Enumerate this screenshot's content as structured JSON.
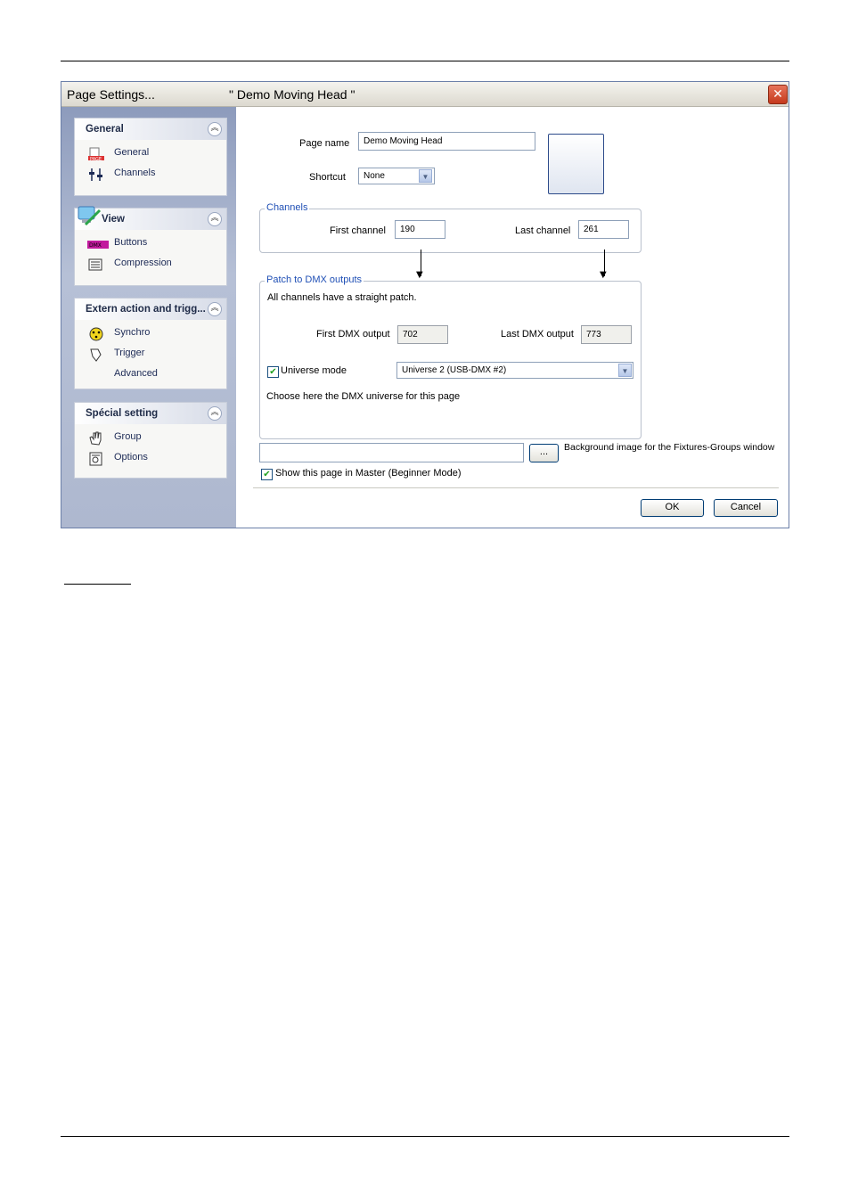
{
  "dialog": {
    "title": "Page  Settings...",
    "page_label": "\" Demo Moving Head \"",
    "close_glyph": "✕"
  },
  "sidebar": {
    "panels": [
      {
        "title": "General",
        "items": [
          {
            "label": "General",
            "icon": "page-icon"
          },
          {
            "label": "Channels",
            "icon": "faders-icon"
          }
        ]
      },
      {
        "title": "View",
        "items": [
          {
            "label": "Buttons",
            "icon": "buttons-icon"
          },
          {
            "label": "Compression",
            "icon": "compression-icon"
          }
        ]
      },
      {
        "title": "Extern action and trigg...",
        "items": [
          {
            "label": "Synchro",
            "icon": "synchro-icon"
          },
          {
            "label": "Trigger",
            "icon": "trigger-icon"
          },
          {
            "label": "Advanced",
            "icon": ""
          }
        ]
      },
      {
        "title": "Spécial setting",
        "items": [
          {
            "label": "Group",
            "icon": "hand-icon"
          },
          {
            "label": "Options",
            "icon": "options-icon"
          }
        ]
      }
    ]
  },
  "form": {
    "page_name_label": "Page name",
    "page_name_value": "Demo Moving Head",
    "shortcut_label": "Shortcut",
    "shortcut_value": "None",
    "channels_legend": "Channels",
    "first_channel_label": "First channel",
    "first_channel_value": "190",
    "last_channel_label": "Last channel",
    "last_channel_value": "261",
    "patch_legend": "Patch to DMX outputs",
    "patch_note": "All channels have a straight patch.",
    "first_dmx_label": "First DMX output",
    "first_dmx_value": "702",
    "last_dmx_label": "Last DMX output",
    "last_dmx_value": "773",
    "universe_mode_label": "Universe mode",
    "universe_mode_checked": true,
    "universe_value": "Universe  2    (USB-DMX #2)",
    "universe_hint": "Choose here the DMX universe for this page",
    "bg_image_value": "",
    "browse_label": "...",
    "bg_image_label": "Background image for the Fixtures-Groups window",
    "show_master_label": "Show this page in Master (Beginner Mode)",
    "show_master_checked": true,
    "ok_label": "OK",
    "cancel_label": "Cancel"
  },
  "colors": {
    "legend_blue": "#1f4fb5",
    "sidebar_top": "#8d9bbc",
    "close_red": "#c5391c"
  }
}
